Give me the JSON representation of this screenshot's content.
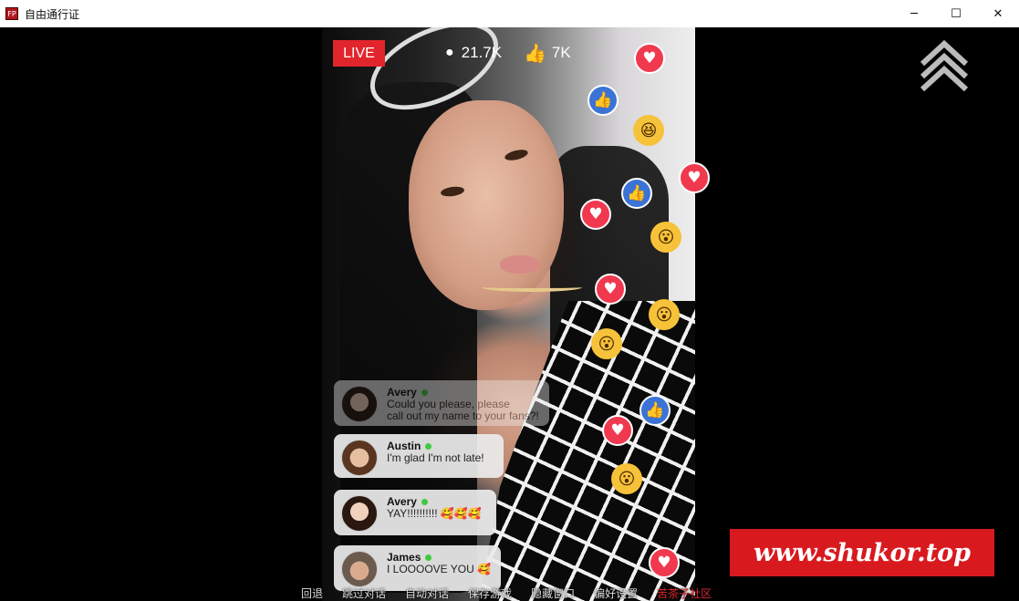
{
  "window": {
    "title": "自由通行证",
    "app_icon_text": "FP",
    "minimize": "─",
    "maximize": "☐",
    "close": "✕"
  },
  "stream": {
    "live_label": "LIVE",
    "viewers": "21.7K",
    "likes": "7K",
    "viewer_icon": "person-icon",
    "like_icon": "thumbs-up-icon"
  },
  "chat": [
    {
      "name": "Avery",
      "message_line1": "Could you please, please",
      "message_line2": "call out my name to your fans?!",
      "faded": true,
      "online": true
    },
    {
      "name": "Austin",
      "message_line1": "I'm glad I'm not late!",
      "message_line2": "",
      "faded": false,
      "online": true
    },
    {
      "name": "Avery",
      "message_line1": "YAY!!!!!!!!!! 🥰🥰🥰",
      "message_line2": "",
      "faded": false,
      "online": true
    },
    {
      "name": "James",
      "message_line1": "I LOOOOVE YOU 🥰",
      "message_line2": "",
      "faded": false,
      "online": true
    }
  ],
  "watermark": "www.shukor.top",
  "quick_menu": {
    "back": "回退",
    "skip": "跳过对话",
    "auto": "自动对话",
    "save": "保存游戏",
    "hide": "隐藏窗口",
    "prefs": "偏好设置",
    "community": "苦茶子社区"
  },
  "colors": {
    "live_red": "#e0262c",
    "heart_red": "#f0394f",
    "like_blue": "#3b73d6",
    "wow_yellow": "#f6c23a",
    "watermark_red": "#d81a1f"
  }
}
